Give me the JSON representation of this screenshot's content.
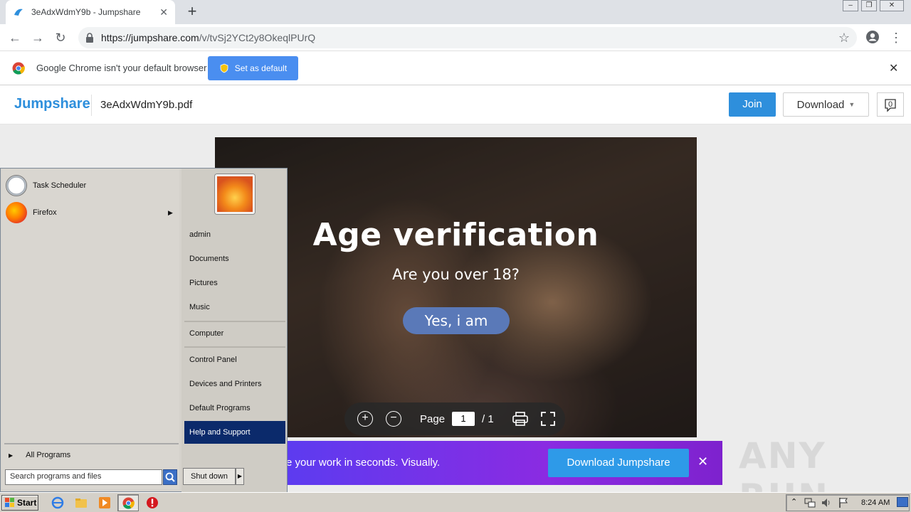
{
  "browser": {
    "tab_title": "3eAdxWdmY9b - Jumpshare",
    "url_host": "https://jumpshare.com",
    "url_path": "/v/tvSj2YCt2y8OkeqlPUrQ",
    "infobar_text": "Google Chrome isn't your default browser",
    "set_default_label": "Set as default"
  },
  "jumpshare": {
    "logo": "Jumpshare",
    "filename": "3eAdxWdmY9b.pdf",
    "join_label": "Join",
    "download_label": "Download",
    "comment_count": "0"
  },
  "pdf": {
    "title": "Age verification",
    "subtitle": "Are you over 18?",
    "button": "Yes, i am",
    "page_label": "Page",
    "page_current": "1",
    "page_total": "/ 1"
  },
  "promo": {
    "text": "e your work in seconds. Visually.",
    "button": "Download Jumpshare"
  },
  "watermark": "ANY RUN",
  "start_menu": {
    "left_items": [
      {
        "label": "Task Scheduler"
      },
      {
        "label": "Firefox"
      }
    ],
    "all_programs": "All Programs",
    "search_placeholder": "Search programs and files",
    "right_items": [
      "admin",
      "Documents",
      "Pictures",
      "Music",
      "Computer",
      "Control Panel",
      "Devices and Printers",
      "Default Programs",
      "Help and Support"
    ],
    "shutdown_label": "Shut down"
  },
  "taskbar": {
    "start_label": "Start",
    "time": "8:24 AM"
  },
  "colors": {
    "jumpshare_blue": "#2e8fdc",
    "start_highlight": "#0b2a6b"
  }
}
